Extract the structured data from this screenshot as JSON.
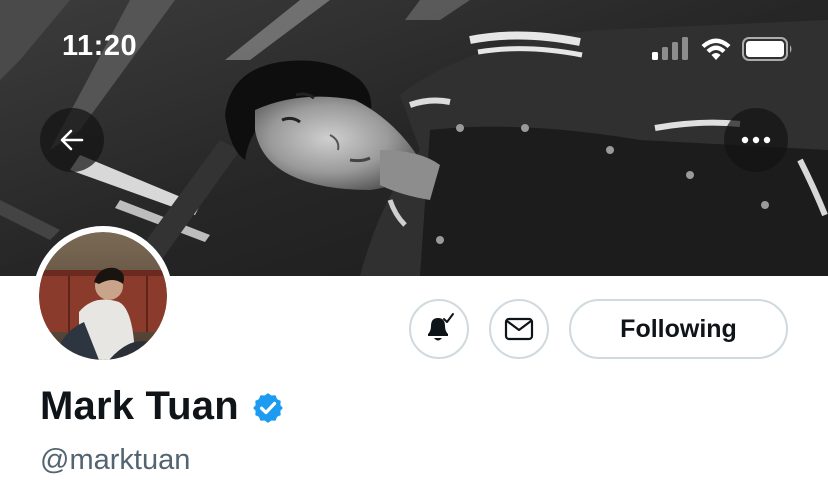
{
  "status_bar": {
    "time": "11:20",
    "icons": [
      "cellular-signal-icon",
      "wifi-icon",
      "battery-icon"
    ]
  },
  "banner": {
    "kind": "black-and-white photo of a person lying on the floor"
  },
  "nav": {
    "back_icon": "arrow-left-icon",
    "more_icon": "more-horizontal-icon"
  },
  "profile": {
    "display_name": "Mark Tuan",
    "verified": true,
    "handle": "@marktuan"
  },
  "actions": {
    "notifications_icon": "bell-check-icon",
    "message_icon": "envelope-icon",
    "follow_label": "Following"
  },
  "colors": {
    "verified_blue": "#1d9bf0",
    "text_primary": "#0f1419",
    "text_secondary": "#536471",
    "button_border": "#cfd9de"
  }
}
